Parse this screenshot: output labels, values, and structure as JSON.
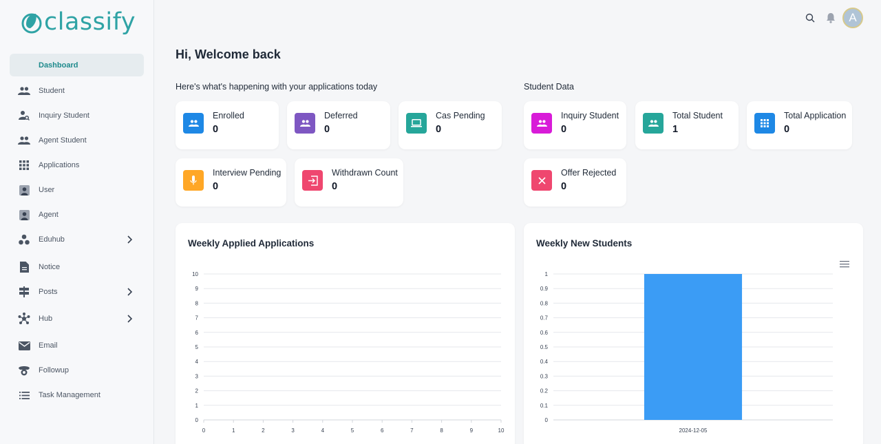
{
  "app": {
    "logo_text": "classify"
  },
  "sidebar": {
    "items": [
      {
        "label": "Dashboard",
        "icon": "dashboard-icon",
        "active": true
      },
      {
        "label": "Student",
        "icon": "people-icon"
      },
      {
        "label": "Inquiry Student",
        "icon": "person-search-icon"
      },
      {
        "label": "Agent Student",
        "icon": "people-icon"
      },
      {
        "label": "Applications",
        "icon": "apps-grid-icon"
      },
      {
        "label": "User",
        "icon": "user-box-icon"
      },
      {
        "label": "Agent",
        "icon": "user-box-icon"
      },
      {
        "label": "Eduhub",
        "icon": "workspaces-icon",
        "has_submenu": true
      },
      {
        "label": "Notice",
        "icon": "document-icon"
      },
      {
        "label": "Posts",
        "icon": "signpost-icon",
        "has_submenu": true
      },
      {
        "label": "Hub",
        "icon": "hub-icon",
        "has_submenu": true
      },
      {
        "label": "Email",
        "icon": "mail-icon"
      },
      {
        "label": "Followup",
        "icon": "followup-icon"
      },
      {
        "label": "Task Management",
        "icon": "list-icon"
      }
    ]
  },
  "topbar": {
    "avatar_letter": "A"
  },
  "main": {
    "title": "Hi, Welcome back",
    "applications_section": "Here's what's happening with your applications today",
    "student_section": "Student Data"
  },
  "stats": {
    "applications": [
      {
        "label": "Enrolled",
        "value": "0",
        "color": "#1e88e5",
        "icon": "people-icon"
      },
      {
        "label": "Deferred",
        "value": "0",
        "color": "#7e57c2",
        "icon": "people-icon"
      },
      {
        "label": "Cas Pending",
        "value": "0",
        "color": "#26a69a",
        "icon": "laptop-icon"
      },
      {
        "label": "Interview Pending",
        "value": "0",
        "color": "#ffa726",
        "icon": "mic-icon"
      },
      {
        "label": "Withdrawn Count",
        "value": "0",
        "color": "#ef476f",
        "icon": "exit-icon"
      }
    ],
    "students": [
      {
        "label": "Inquiry Student",
        "value": "0",
        "color": "#d81bd8",
        "icon": "people-icon"
      },
      {
        "label": "Total Student",
        "value": "1",
        "color": "#26a69a",
        "icon": "people-icon"
      },
      {
        "label": "Total Application",
        "value": "0",
        "color": "#1e88e5",
        "icon": "apps-grid-icon"
      },
      {
        "label": "Offer Rejected",
        "value": "0",
        "color": "#ef476f",
        "icon": "close-icon"
      }
    ]
  },
  "chart_data": [
    {
      "type": "scatter",
      "title": "Weekly Applied Applications",
      "x": [],
      "y": [],
      "xlim": [
        0,
        10
      ],
      "ylim": [
        0,
        10
      ],
      "x_ticks": [
        "0",
        "1",
        "2",
        "3",
        "4",
        "5",
        "6",
        "7",
        "8",
        "9",
        "10"
      ],
      "y_ticks": [
        "0",
        "1",
        "2",
        "3",
        "4",
        "5",
        "6",
        "7",
        "8",
        "9",
        "10"
      ],
      "grid": true
    },
    {
      "type": "bar",
      "title": "Weekly New Students",
      "categories": [
        "2024-12-05"
      ],
      "values": [
        1
      ],
      "ylim": [
        0,
        1
      ],
      "y_ticks": [
        "0",
        "0.1",
        "0.2",
        "0.3",
        "0.4",
        "0.5",
        "0.6",
        "0.7",
        "0.8",
        "0.9",
        "1"
      ],
      "bar_color": "#3b9cf5",
      "grid": true
    }
  ]
}
